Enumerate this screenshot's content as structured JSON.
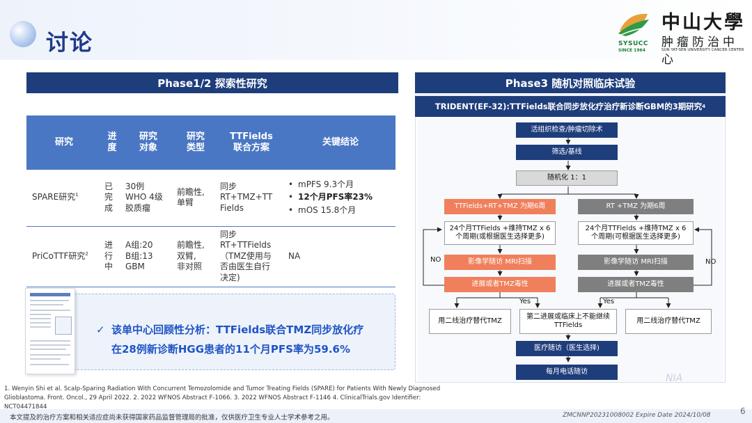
{
  "page": {
    "title": "讨论",
    "slide_number": "6",
    "code": "ZMCNNP20231008002 Expire Date 2024/10/08",
    "disclaimer": "本文提及的治疗方案和相关适应症尚未获得国家药品监督管理局的批准，仅供医疗卫生专业人士学术参考之用。",
    "watermark": "NIA"
  },
  "logo": {
    "abbr": "SYSUCC",
    "since": "SINCE 1964",
    "name_cn": "中山大學",
    "name_cn2": "肿瘤防治中心",
    "name_en": "SUN YAT-SEN UNIVERSITY CANCER CENTER"
  },
  "left_panel": {
    "header": "Phase1/2 探索性研究",
    "columns": [
      "研究",
      "进\n度",
      "研究\n对象",
      "研究\n类型",
      "TTFields\n联合方案",
      "关键结论"
    ],
    "rows": [
      {
        "study": "SPARE研究",
        "study_sup": "1",
        "progress": "已\n完\n成",
        "subject": "30例\nWHO 4级\n胶质瘤",
        "type": "前瞻性,\n单臂",
        "regimen": "同步\nRT+TMZ+TT\nFields",
        "conclusions": [
          "mPFS 9.3个月",
          "12个月PFS率23%",
          "mOS 15.8个月"
        ]
      },
      {
        "study": "PriCoTTF研究",
        "study_sup": "2",
        "progress": "进\n行\n中",
        "subject": "A组:20\nB组:13\nGBM",
        "type": "前瞻性,\n双臂,\n非对照",
        "regimen": "同步\nRT+TTFields\n（TMZ使用与\n否由医生自行\n决定)",
        "conclusion": "NA"
      }
    ],
    "summary_line1": "该单中心回顾性分析：TTFields联合TMZ同步放化疗",
    "summary_line2": "在28例新诊断HGG患者的11个月PFS率为59.6%",
    "check_icon": "✓"
  },
  "right_panel": {
    "header": "Phase3 随机对照临床试验",
    "subheader": "TRIDENT(EF-32):TTFields联合同步放化疗治疗新诊断GBM的3期研究",
    "subheader_sup": "4",
    "flow": {
      "surgery": "活组织检查/肿瘤切除术",
      "screening": "筛选/基线",
      "randomize": "随机化 1：1",
      "arm_a": "TTFields+RT+TMZ 为期6周",
      "arm_b": "RT +TMZ 为期6周",
      "maint_a": "24个月TTFields +维持TMZ x 6个周期(或根据医生选择更多)",
      "maint_b": "24个月TTFields +维持TMZ x 6个周期(可根据医生选择更多)",
      "mri_a": "影像学随访  MRI扫描",
      "mri_b": "影像学随访  MRI扫描",
      "prog_a": "进展或者TMZ毒性",
      "prog_b": "进展或者TMZ毒性",
      "no_label": "NO",
      "yes_label": "Yes",
      "left_out": "用二线治疗替代TMZ",
      "middle_out": "第二进展或临床上不能继续TTFields",
      "right_out": "用二线治疗替代TMZ",
      "followup": "医疗随访（医生选择)",
      "phone": "每月电话随访"
    }
  },
  "footnotes": {
    "line1": "1. Wenyin Shi et al. Scalp-Sparing Radiation With Concurrent Temozolomide and Tumor Treating Fields (SPARE) for Patients With Newly Diagnosed",
    "line2": "Glioblastoma. Front. Oncol., 29 April 2022. 2. 2022 WFNOS Abstract F-1066. 3. 2022 WFNOS Abstract F-1146 4. ClinicalTrials.gov Identifier: NCT04471844"
  },
  "colors": {
    "navy": "#1e3d7b",
    "table_header": "#4a77c4",
    "orange": "#f07f5b",
    "dark_gray": "#7f7f7f",
    "summary_blue": "#1f54c5"
  }
}
